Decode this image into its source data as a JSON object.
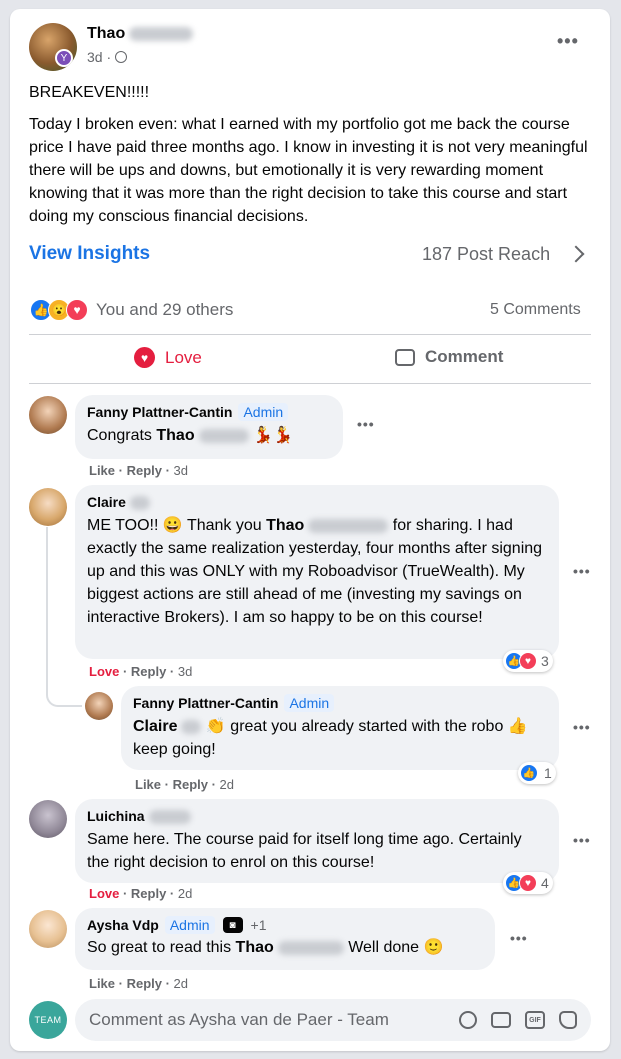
{
  "post": {
    "author": "Thao",
    "time": "3d",
    "title_line": "BREAKEVEN!!!!!",
    "body": "Today I broken even: what I earned with my portfolio got me back the course price I have paid three months ago. I know in investing it is not very meaningful there will be ups and downs, but emotionally it is very rewarding moment knowing that it was more than the right decision to take this course and start doing my conscious financial decisions.",
    "view_insights": "View Insights",
    "post_reach": "187 Post Reach",
    "reactions_text": "You and 29 others",
    "comments_count": "5 Comments",
    "love_label": "Love",
    "comment_label": "Comment"
  },
  "comments": [
    {
      "author": "Fanny Plattner-Cantin",
      "badge": "Admin",
      "text_prefix": "Congrats",
      "mention": "Thao",
      "text_suffix": "💃💃",
      "action1": "Like",
      "action2": "Reply",
      "time": "3d"
    },
    {
      "author": "Claire",
      "text_1": "ME TOO!! 😀 Thank you",
      "mention": "Thao",
      "text_2": "for sharing. I had exactly the same realization yesterday, four months after signing up and this was ONLY with my Roboadvisor (TrueWealth). My biggest actions are still ahead of me (investing my savings on interactive Brokers). I am so happy to be on this course!",
      "action1": "Love",
      "action2": "Reply",
      "time": "3d",
      "reaction_count": "3"
    },
    {
      "author": "Fanny Plattner-Cantin",
      "badge": "Admin",
      "mention": "Claire",
      "text_1": "👏 great you already started with the robo 👍 keep going!",
      "action1": "Like",
      "action2": "Reply",
      "time": "2d",
      "reaction_count": "1"
    },
    {
      "author": "Luichina",
      "text": "Same here. The course paid for itself long time ago. Certainly the right decision to enrol on this course!",
      "action1": "Love",
      "action2": "Reply",
      "time": "2d",
      "reaction_count": "4"
    },
    {
      "author": "Aysha Vdp",
      "badge": "Admin",
      "extra_count": "+1",
      "text_prefix": "So great to read this",
      "mention": "Thao",
      "text_suffix": "Well done 🙂",
      "action1": "Like",
      "action2": "Reply",
      "time": "2d"
    }
  ],
  "composer": {
    "avatar_label": "TEAM",
    "placeholder": "Comment as Aysha van de Paer - Team"
  },
  "colors": {
    "link_blue": "#1b74e4",
    "love_red": "#e41e3f",
    "muted": "#65676b"
  }
}
